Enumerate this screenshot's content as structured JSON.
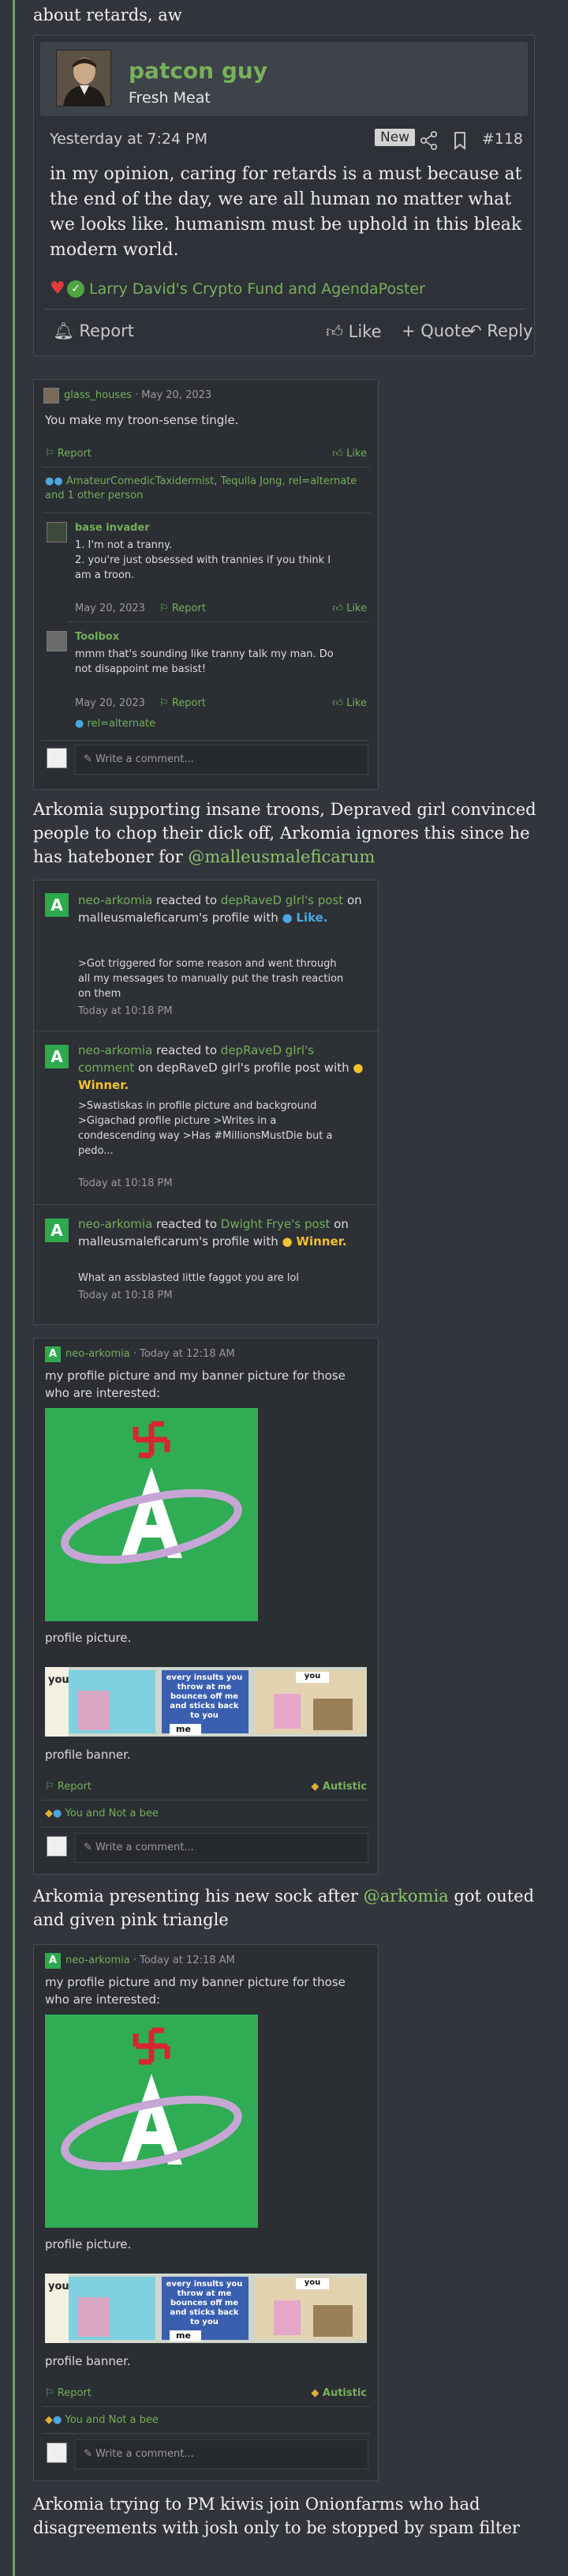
{
  "intro_text": "about retards, aw",
  "post": {
    "username": "patcon guy",
    "user_title": "Fresh Meat",
    "timestamp": "Yesterday at 7:24 PM",
    "badge": "New",
    "number": "#118",
    "body": "in my opinion, caring for retards is a must because at the end of the day, we are all human no matter what we looks like. humanism must be uphold in this bleak modern world.",
    "reactions_text": "Larry David's Crypto Fund and AgendaPoster",
    "actions": {
      "report": "Report",
      "like": "Like",
      "quote": "Quote",
      "reply": "Reply"
    }
  },
  "shot1": {
    "author": "glass_houses",
    "date": "May 20, 2023",
    "body": "You make my troon-sense tingle.",
    "report": "Report",
    "like": "Like",
    "reactors": "AmateurComedicTaxidermist, Tequila Jong, rel=alternate and 1 other person",
    "replies": [
      {
        "name": "base invader",
        "lines": [
          "1. I'm not a tranny.",
          "2. you're just obsessed with trannies if you think I",
          "am a troon."
        ],
        "date": "May 20, 2023",
        "report": "Report",
        "like": "Like"
      },
      {
        "name": "Toolbox",
        "lines": [
          "mmm that's sounding like tranny talk my man. Do",
          "not disappoint me basist!"
        ],
        "date": "May 20, 2023",
        "report": "Report",
        "like": "Like",
        "reactor": "rel=alternate"
      }
    ],
    "comment_placeholder": "Write a comment..."
  },
  "para2": {
    "text": "Arkomia supporting insane troons, Depraved girl convinced people to chop their dick off, Arkomia ignores this since he has hateboner for",
    "mention": "@malleusmaleficarum"
  },
  "shot2": {
    "items": [
      {
        "actor": "neo-arkomia",
        "verb": "reacted to",
        "target": "depRaveD gIrl's post",
        "rest": "on malleusmaleficarum's profile with",
        "reaction": "Like.",
        "lines": [
          ">Got triggered for some reason and went through",
          "all my messages to manually put the trash reaction",
          "on them"
        ],
        "time": "Today at 10:18 PM"
      },
      {
        "actor": "neo-arkomia",
        "verb": "reacted to",
        "target": "depRaveD gIrl's comment",
        "rest": "on depRaveD gIrl's profile post with",
        "reaction": "Winner.",
        "lines": [
          ">Swastiskas in profile picture and background",
          ">Gigachad profile picture >Writes in a",
          "condescending way >Has #MillionsMustDie but a",
          "pedo..."
        ],
        "time": "Today at 10:18 PM"
      },
      {
        "actor": "neo-arkomia",
        "verb": "reacted to",
        "target": "Dwight Frye's post",
        "rest": "on malleusmaleficarum's profile with",
        "reaction": "Winner.",
        "lines": [
          "What an assblasted little faggot you are lol"
        ],
        "time": "Today at 10:18 PM"
      }
    ]
  },
  "profile_post": {
    "author": "neo-arkomia",
    "time": "Today at 12:18 AM",
    "intro1": "my profile picture and my banner picture for those",
    "intro2": "who are interested:",
    "caption_picture": "profile picture.",
    "caption_banner": "profile banner.",
    "banner_you": "you",
    "banner_words": "every insults you throw at me bounces off me and sticks back to you",
    "banner_me": "me",
    "report": "Report",
    "autistic": "Autistic",
    "reactors": "You and Not a bee",
    "comment_placeholder": "Write a comment..."
  },
  "para3": {
    "text1": "Arkomia presenting his new sock after",
    "mention": "@arkomia",
    "text2": "got outed and given pink triangle"
  },
  "para4": {
    "text": "Arkomia trying to PM kiwis join Onionfarms who had disagreements with josh only to be stopped by spam filter"
  },
  "colors": {
    "background": "#32353b",
    "accent_green": "#78b05c",
    "card_bg": "#2b2e33",
    "avatar_green": "#30ac55"
  }
}
